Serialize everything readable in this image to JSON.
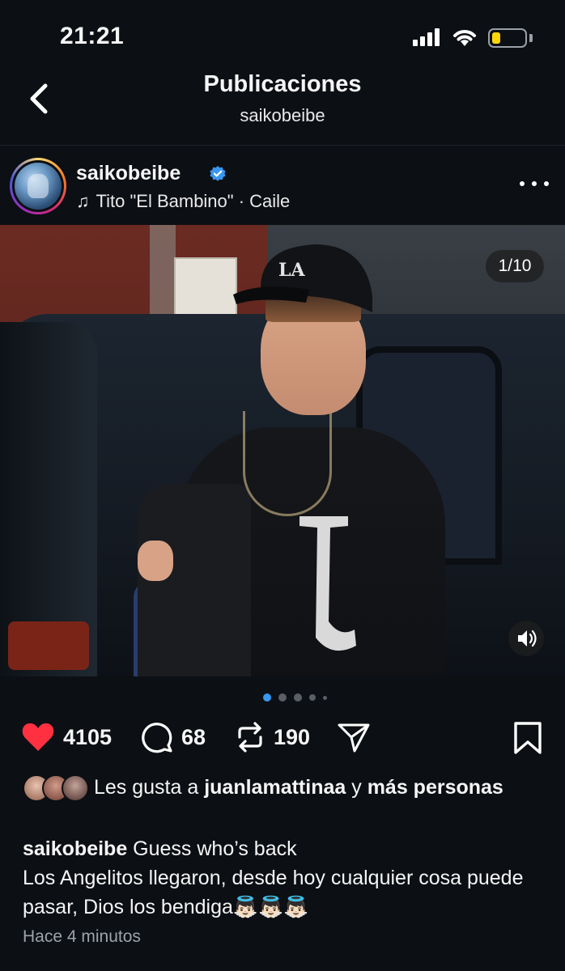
{
  "status_bar": {
    "time": "21:21",
    "battery_level": 0.25,
    "battery_color": "#ffd60a"
  },
  "header": {
    "title": "Publicaciones",
    "subtitle": "saikobeibe",
    "back_icon": "chevron-left-icon"
  },
  "post": {
    "username": "saikobeibe",
    "verified": true,
    "verified_color": "#3897f0",
    "music": "Tito \"El Bambino\" · Caile",
    "music_icon": "music-note-icon",
    "media_counter": "1/10",
    "carousel_position": 1,
    "carousel_total": 10,
    "actions": {
      "likes": "4105",
      "comments": "68",
      "reposts": "190",
      "liked": true,
      "like_color": "#ff3040"
    },
    "liked_by": {
      "prefix": "Les gusta a ",
      "user": "juanlamattinaa",
      "connector": " y ",
      "suffix": "más personas"
    },
    "caption": {
      "user": "saikobeibe",
      "headline": " Guess who’s back",
      "body": "Los Angelitos llegaron, desde hoy cualquier cosa puede pasar, Dios los bendiga👼🏻👼🏻👼🏻"
    },
    "timestamp": "Hace 4 minutos"
  }
}
